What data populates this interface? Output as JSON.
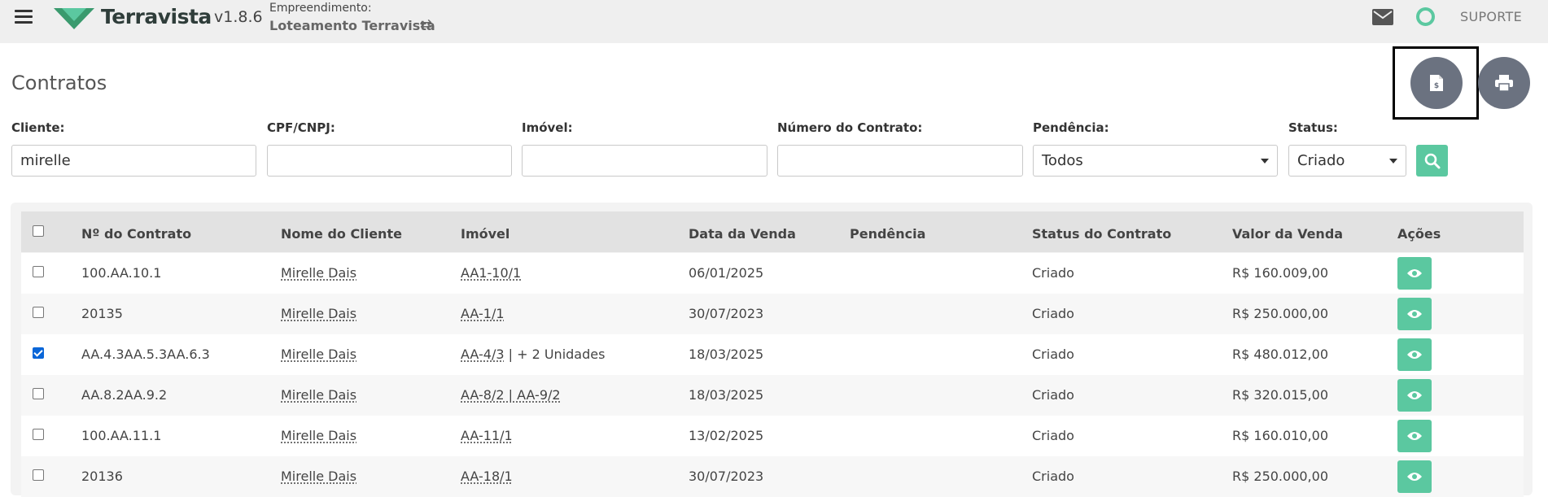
{
  "header": {
    "brand": "Terravista",
    "version": "v1.8.6",
    "empreendimento_label": "Empreendimento:",
    "empreendimento_name": "Loteamento Terravista",
    "swap_glyph": "⇄",
    "support_label": "SUPORTE"
  },
  "page": {
    "title": "Contratos"
  },
  "filters": {
    "cliente": {
      "label": "Cliente:",
      "value": "mirelle"
    },
    "cpf": {
      "label": "CPF/CNPJ:",
      "value": ""
    },
    "imovel": {
      "label": "Imóvel:",
      "value": ""
    },
    "numero": {
      "label": "Número do Contrato:",
      "value": ""
    },
    "pendencia": {
      "label": "Pendência:",
      "value": "Todos"
    },
    "status": {
      "label": "Status:",
      "value": "Criado"
    }
  },
  "table": {
    "headers": {
      "numero": "Nº do Contrato",
      "cliente": "Nome do Cliente",
      "imovel": "Imóvel",
      "data": "Data da Venda",
      "pendencia": "Pendência",
      "status": "Status do Contrato",
      "valor": "Valor da Venda",
      "acoes": "Ações"
    },
    "rows": [
      {
        "checked": false,
        "numero": "100.AA.10.1",
        "cliente": "Mirelle Dais",
        "imovel": "AA1-10/1",
        "imovel_extra": "",
        "data": "06/01/2025",
        "pendencia": "",
        "status": "Criado",
        "valor": "R$ 160.009,00"
      },
      {
        "checked": false,
        "numero": "20135",
        "cliente": "Mirelle Dais",
        "imovel": "AA-1/1",
        "imovel_extra": "",
        "data": "30/07/2023",
        "pendencia": "",
        "status": "Criado",
        "valor": "R$ 250.000,00"
      },
      {
        "checked": true,
        "numero": "AA.4.3AA.5.3AA.6.3",
        "cliente": "Mirelle Dais",
        "imovel": "AA-4/3",
        "imovel_extra": " | + 2 Unidades",
        "data": "18/03/2025",
        "pendencia": "",
        "status": "Criado",
        "valor": "R$ 480.012,00"
      },
      {
        "checked": false,
        "numero": "AA.8.2AA.9.2",
        "cliente": "Mirelle Dais",
        "imovel": "AA-8/2 | AA-9/2",
        "imovel_extra": "",
        "data": "18/03/2025",
        "pendencia": "",
        "status": "Criado",
        "valor": "R$ 320.015,00"
      },
      {
        "checked": false,
        "numero": "100.AA.11.1",
        "cliente": "Mirelle Dais",
        "imovel": "AA-11/1",
        "imovel_extra": "",
        "data": "13/02/2025",
        "pendencia": "",
        "status": "Criado",
        "valor": "R$ 160.010,00"
      },
      {
        "checked": false,
        "numero": "20136",
        "cliente": "Mirelle Dais",
        "imovel": "AA-18/1",
        "imovel_extra": "",
        "data": "30/07/2023",
        "pendencia": "",
        "status": "Criado",
        "valor": "R$ 250.000,00"
      }
    ]
  },
  "colors": {
    "accent": "#5bc8a0",
    "fab": "#6b7280",
    "header_bg": "#efefef"
  }
}
